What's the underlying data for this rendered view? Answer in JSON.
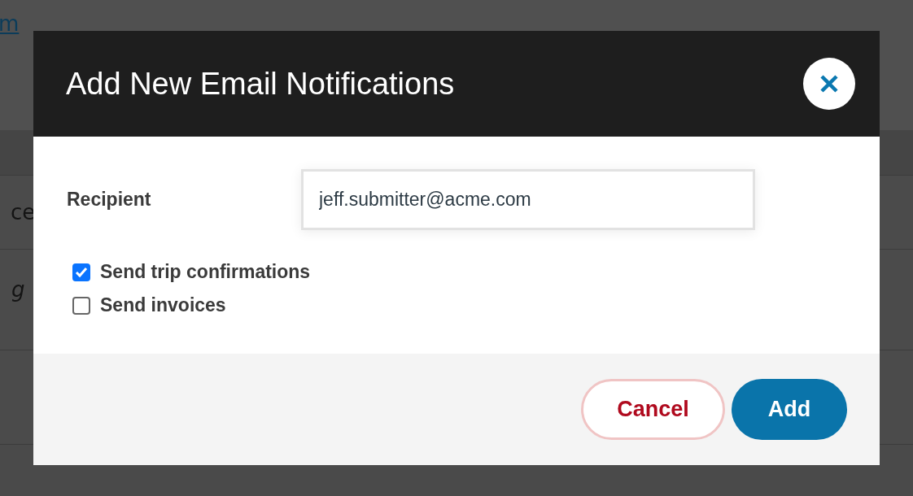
{
  "background": {
    "link": "m",
    "row_1": "ce",
    "row_2": "g"
  },
  "dialog": {
    "title": "Add New Email Notifications",
    "recipient": {
      "label": "Recipient",
      "value": "jeff.submitter@acme.com"
    },
    "options": [
      {
        "label": "Send trip confirmations",
        "checked": true
      },
      {
        "label": "Send invoices",
        "checked": false
      }
    ],
    "buttons": [
      {
        "label": "Cancel",
        "kind": "secondary"
      },
      {
        "label": "Add",
        "kind": "primary"
      }
    ]
  }
}
